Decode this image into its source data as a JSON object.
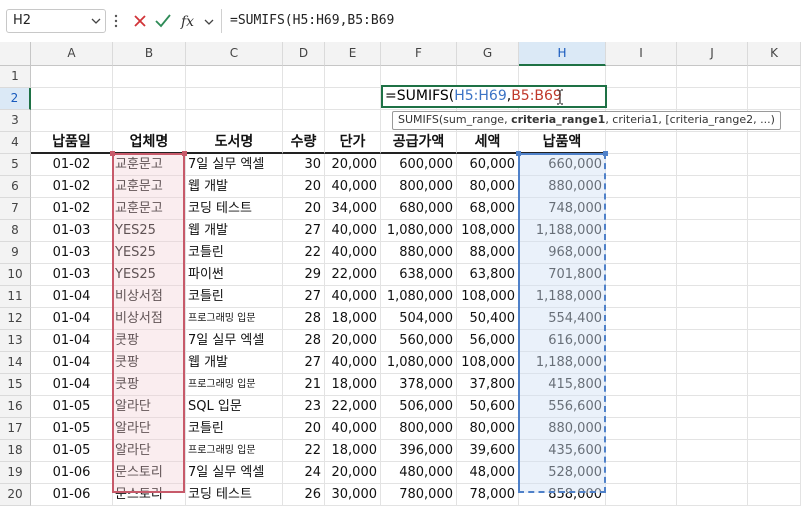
{
  "namebox": {
    "value": "H2"
  },
  "formula_bar": {
    "text": "=SUMIFS(H5:H69,B5:B69"
  },
  "columns": [
    "A",
    "B",
    "C",
    "D",
    "E",
    "F",
    "G",
    "H",
    "I",
    "J",
    "K"
  ],
  "selected_column": "H",
  "rows": [
    "1",
    "2",
    "3",
    "4",
    "5",
    "6",
    "7",
    "8",
    "9",
    "10",
    "11",
    "12",
    "13",
    "14",
    "15",
    "16",
    "17",
    "18",
    "19",
    "20"
  ],
  "selected_row": "2",
  "edit_cell": {
    "prefix": "=SUMIFS(",
    "ref1": "H5:H69",
    "sep": ",",
    "ref2": "B5:B69"
  },
  "tooltip": {
    "fn": "SUMIFS(sum_range, ",
    "bold": "criteria_range1",
    "rest": ", criteria1, [criteria_range2, ...)"
  },
  "table": {
    "headers": [
      "납품일",
      "업체명",
      "도서명",
      "수량",
      "단가",
      "공급가액",
      "세액",
      "납품액"
    ],
    "rows": [
      [
        "01-02",
        "교훈문고",
        "7일 실무 엑셀",
        "30",
        "20,000",
        "600,000",
        "60,000",
        "660,000"
      ],
      [
        "01-02",
        "교훈문고",
        "웹 개발",
        "20",
        "40,000",
        "800,000",
        "80,000",
        "880,000"
      ],
      [
        "01-02",
        "교훈문고",
        "코딩 테스트",
        "20",
        "34,000",
        "680,000",
        "68,000",
        "748,000"
      ],
      [
        "01-03",
        "YES25",
        "웹 개발",
        "27",
        "40,000",
        "1,080,000",
        "108,000",
        "1,188,000"
      ],
      [
        "01-03",
        "YES25",
        "코틀린",
        "22",
        "40,000",
        "880,000",
        "88,000",
        "968,000"
      ],
      [
        "01-03",
        "YES25",
        "파이썬",
        "29",
        "22,000",
        "638,000",
        "63,800",
        "701,800"
      ],
      [
        "01-04",
        "비상서점",
        "코틀린",
        "27",
        "40,000",
        "1,080,000",
        "108,000",
        "1,188,000"
      ],
      [
        "01-04",
        "비상서점",
        "프로그래밍 입문",
        "28",
        "18,000",
        "504,000",
        "50,400",
        "554,400"
      ],
      [
        "01-04",
        "쿳팡",
        "7일 실무 엑셀",
        "28",
        "20,000",
        "560,000",
        "56,000",
        "616,000"
      ],
      [
        "01-04",
        "쿳팡",
        "웹 개발",
        "27",
        "40,000",
        "1,080,000",
        "108,000",
        "1,188,000"
      ],
      [
        "01-04",
        "쿳팡",
        "프로그래밍 입문",
        "21",
        "18,000",
        "378,000",
        "37,800",
        "415,800"
      ],
      [
        "01-05",
        "알라단",
        "SQL 입문",
        "23",
        "22,000",
        "506,000",
        "50,600",
        "556,600"
      ],
      [
        "01-05",
        "알라단",
        "코틀린",
        "20",
        "40,000",
        "800,000",
        "80,000",
        "880,000"
      ],
      [
        "01-05",
        "알라단",
        "프로그래밍 입문",
        "22",
        "18,000",
        "396,000",
        "39,600",
        "435,600"
      ],
      [
        "01-06",
        "문스토리",
        "7일 실무 엑셀",
        "24",
        "20,000",
        "480,000",
        "48,000",
        "528,000"
      ],
      [
        "01-06",
        "문스토리",
        "코딩 테스트",
        "26",
        "30,000",
        "780,000",
        "78,000",
        "858,000"
      ]
    ]
  },
  "colors": {
    "accent": "#1e7145",
    "range_red": "#c75a6a",
    "range_blue": "#4f81c9"
  }
}
